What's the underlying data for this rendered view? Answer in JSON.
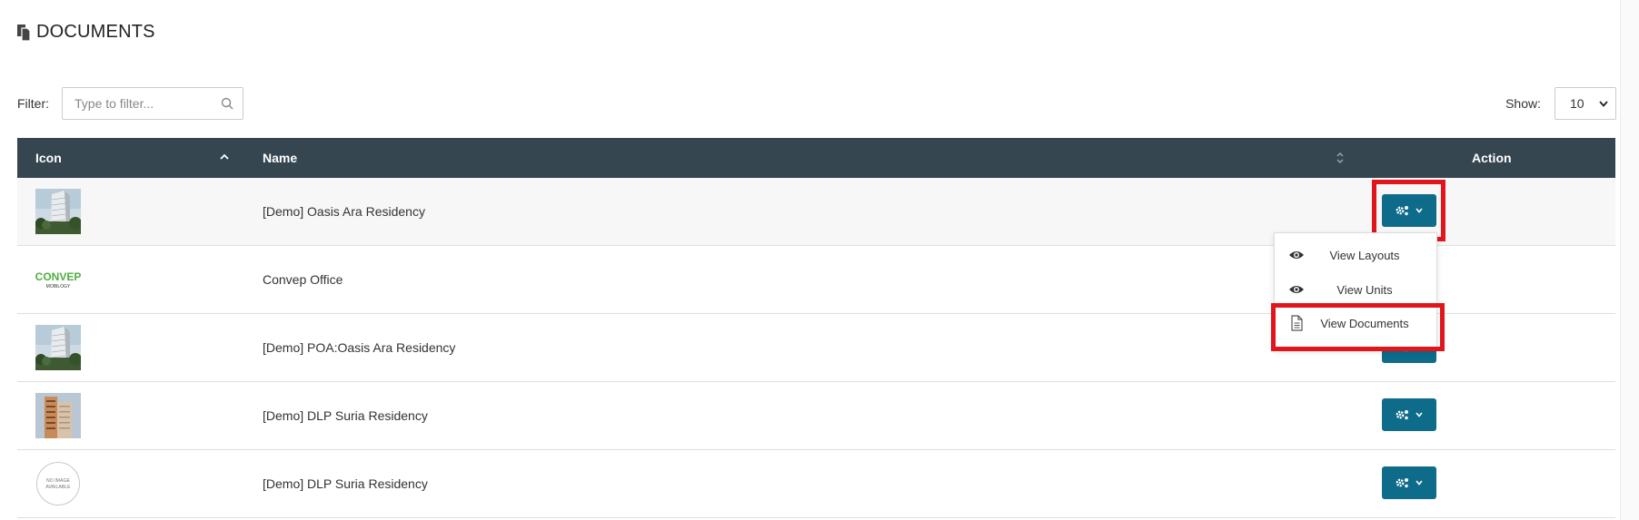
{
  "page": {
    "title": "DOCUMENTS",
    "icon": "documents-icon"
  },
  "filter": {
    "label": "Filter:",
    "placeholder": "Type to filter...",
    "value": ""
  },
  "show": {
    "label": "Show:",
    "selected": "10"
  },
  "table": {
    "columns": [
      {
        "label": "Icon",
        "sort": "ascending"
      },
      {
        "label": "Name",
        "sort": "unsorted"
      },
      {
        "label": "Action"
      }
    ],
    "rows": [
      {
        "thumbnail": "building-oasis-ara",
        "name": "[Demo] Oasis Ara Residency"
      },
      {
        "thumbnail": "convep-logo",
        "name": "Convep Office"
      },
      {
        "thumbnail": "building-oasis-ara",
        "name": "[Demo] POA:Oasis Ara Residency"
      },
      {
        "thumbnail": "building-suria",
        "name": "[Demo] DLP Suria Residency"
      },
      {
        "thumbnail": "no-image",
        "name": "[Demo] DLP Suria Residency"
      }
    ]
  },
  "logos": {
    "convep_top": "CONVEP",
    "convep_bottom": "MOBILOGY",
    "no_image_line1": "NO IMAGE",
    "no_image_line2": "AVAILABLE"
  },
  "dropdown": {
    "items": [
      {
        "label": "View Layouts",
        "icon": "eye-icon"
      },
      {
        "label": "View Units",
        "icon": "eye-icon"
      },
      {
        "label": "View Documents",
        "icon": "document-icon"
      }
    ]
  },
  "colors": {
    "header_bg": "#354650",
    "action_button": "#0e6b8a",
    "highlight": "#e0161c"
  }
}
